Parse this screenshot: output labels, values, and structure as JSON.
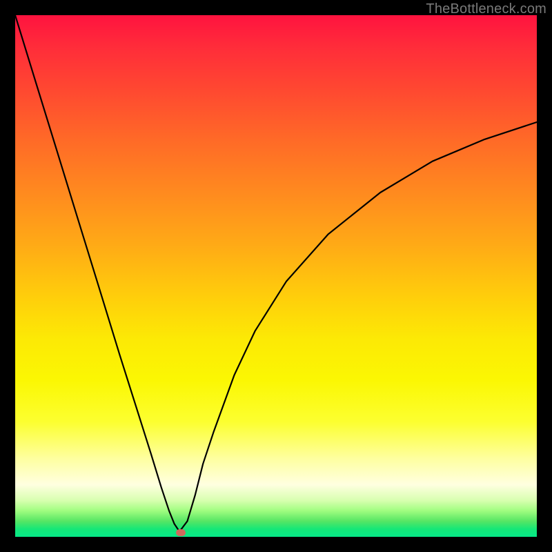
{
  "watermark": "TheBottleneck.com",
  "marker": {
    "color": "#cf6a5e",
    "cx_frac": 0.318,
    "cy_frac": 0.992
  },
  "chart_data": {
    "type": "line",
    "title": "",
    "xlabel": "",
    "ylabel": "",
    "xlim": [
      0,
      1
    ],
    "ylim": [
      0,
      1
    ],
    "series": [
      {
        "name": "curve",
        "x": [
          0.0,
          0.04,
          0.08,
          0.12,
          0.16,
          0.2,
          0.23,
          0.26,
          0.28,
          0.295,
          0.305,
          0.315,
          0.33,
          0.345,
          0.36,
          0.38,
          0.42,
          0.46,
          0.52,
          0.6,
          0.7,
          0.8,
          0.9,
          1.0
        ],
        "y": [
          1.0,
          0.87,
          0.74,
          0.61,
          0.48,
          0.35,
          0.255,
          0.16,
          0.095,
          0.05,
          0.025,
          0.01,
          0.03,
          0.08,
          0.14,
          0.2,
          0.31,
          0.395,
          0.49,
          0.58,
          0.66,
          0.72,
          0.762,
          0.795
        ]
      }
    ],
    "annotations": []
  }
}
